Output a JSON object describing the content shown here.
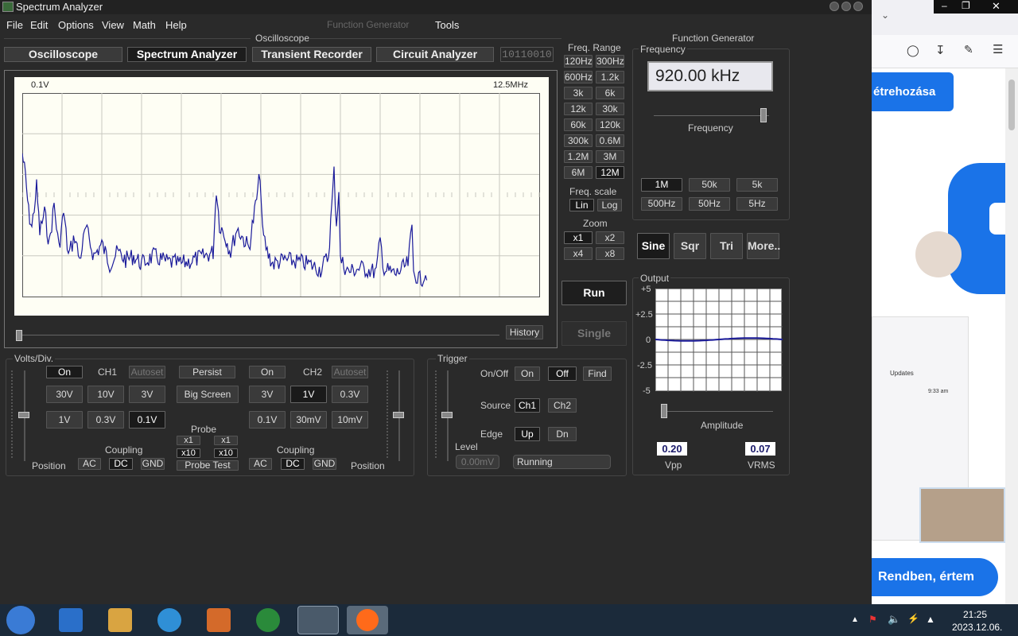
{
  "window": {
    "title": "Spectrum Analyzer"
  },
  "menu": [
    "File",
    "Edit",
    "Options",
    "View",
    "Math",
    "Help"
  ],
  "menu_extra": {
    "function_generator": "Function Generator",
    "tools": "Tools"
  },
  "section_titles": {
    "oscilloscope": "Oscilloscope",
    "function_generator": "Function Generator"
  },
  "tabs": [
    {
      "label": "Oscilloscope"
    },
    {
      "label": "Spectrum Analyzer"
    },
    {
      "label": "Transient Recorder"
    },
    {
      "label": "Circuit Analyzer"
    }
  ],
  "binary_display": "10110010",
  "screen": {
    "volt_label": "0.1V",
    "freq_label": "12.5MHz",
    "history": "History"
  },
  "freq_range": {
    "title": "Freq. Range",
    "buttons": [
      "120Hz",
      "300Hz",
      "600Hz",
      "1.2k",
      "3k",
      "6k",
      "12k",
      "30k",
      "60k",
      "120k",
      "300k",
      "0.6M",
      "1.2M",
      "3M",
      "6M",
      "12M"
    ],
    "selected": "12M",
    "scale_title": "Freq. scale",
    "scale": [
      "Lin",
      "Log"
    ],
    "zoom_title": "Zoom",
    "zoom": [
      "x1",
      "x2",
      "x4",
      "x8"
    ]
  },
  "run": "Run",
  "single": "Single",
  "funcgen": {
    "frequency_title": "Frequency",
    "frequency_value": "920.00 kHz",
    "frequency_slider_label": "Frequency",
    "frequency_slider_level": 0.95,
    "range_buttons": [
      "1M",
      "50k",
      "5k",
      "500Hz",
      "50Hz",
      "5Hz"
    ],
    "range_selected": "1M",
    "waves": [
      "Sine",
      "Sqr",
      "Tri",
      "More.."
    ],
    "wave_selected": "Sine",
    "output_title": "Output",
    "output_ticks": [
      "+5",
      "+2.5",
      "0",
      "-2.5",
      "-5"
    ],
    "amplitude_label": "Amplitude",
    "amplitude_level": 0.02,
    "vpp_value": "0.20",
    "vpp_label": "Vpp",
    "vrms_value": "0.07",
    "vrms_label": "VRMS"
  },
  "volts": {
    "title": "Volts/Div.",
    "ch1": {
      "on": "On",
      "label": "CH1",
      "autoset": "Autoset",
      "buttons": [
        "30V",
        "10V",
        "3V",
        "1V",
        "0.3V",
        "0.1V"
      ],
      "selected": "0.1V"
    },
    "ch2": {
      "on": "On",
      "label": "CH2",
      "autoset": "Autoset",
      "buttons": [
        "3V",
        "1V",
        "0.3V",
        "0.1V",
        "30mV",
        "10mV"
      ],
      "selected": "1V"
    },
    "persist": "Persist",
    "big_screen": "Big Screen",
    "probe_title": "Probe",
    "probe": [
      "x1",
      "x1",
      "x10",
      "x10"
    ],
    "probe_test": "Probe Test",
    "coupling_title": "Coupling",
    "coupling": [
      "AC",
      "DC",
      "GND"
    ],
    "position": "Position"
  },
  "trigger": {
    "title": "Trigger",
    "onoff_label": "On/Off",
    "onoff": [
      "On",
      "Off"
    ],
    "find": "Find",
    "source_label": "Source",
    "source": [
      "Ch1",
      "Ch2"
    ],
    "edge_label": "Edge",
    "edge": [
      "Up",
      "Dn"
    ],
    "level_label": "Level",
    "level_value": "0.00mV",
    "status": "Running"
  },
  "browser": {
    "button_top": "étrehozása",
    "button_bottom": "Rendben, értem",
    "updates": "Updates",
    "time": "9:33 am"
  },
  "taskbar": {
    "time": "21:25",
    "date": "2023.12.06."
  },
  "colors": {
    "trace": "#1a1a9a",
    "screen_bg": "#fefef4",
    "accent_blue": "#1a73e8"
  }
}
